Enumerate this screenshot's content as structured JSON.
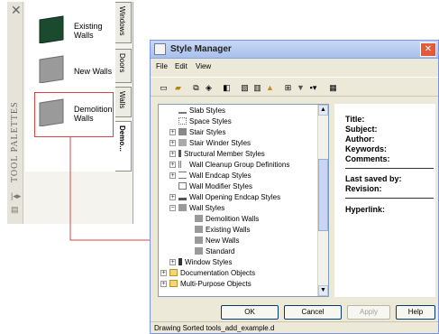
{
  "palette": {
    "title": "TOOL PALETTES",
    "tools": [
      {
        "label": "Existing Walls",
        "color": "#1b4a2e"
      },
      {
        "label": "New Walls",
        "color": "#9a9a9a"
      },
      {
        "label": "Demolition Walls",
        "color": "#9a9a9a"
      }
    ],
    "tabs": [
      "Windows",
      "Doors",
      "Walls",
      "Demo..."
    ]
  },
  "window": {
    "title": "Style Manager",
    "menus": [
      "File",
      "Edit",
      "View"
    ],
    "tree": [
      {
        "label": "Slab Styles",
        "level": 2,
        "expander": ""
      },
      {
        "label": "Space Styles",
        "level": 2,
        "expander": ""
      },
      {
        "label": "Stair Styles",
        "level": 2,
        "expander": "+"
      },
      {
        "label": "Stair Winder Styles",
        "level": 2,
        "expander": "+"
      },
      {
        "label": "Structural Member Styles",
        "level": 2,
        "expander": "+"
      },
      {
        "label": "Wall Cleanup Group Definitions",
        "level": 2,
        "expander": "+"
      },
      {
        "label": "Wall Endcap Styles",
        "level": 2,
        "expander": "+"
      },
      {
        "label": "Wall Modifier Styles",
        "level": 2,
        "expander": ""
      },
      {
        "label": "Wall Opening Endcap Styles",
        "level": 2,
        "expander": "+"
      },
      {
        "label": "Wall Styles",
        "level": 2,
        "expander": "-"
      },
      {
        "label": "Demolition Walls",
        "level": 3,
        "expander": ""
      },
      {
        "label": "Existing Walls",
        "level": 3,
        "expander": ""
      },
      {
        "label": "New Walls",
        "level": 3,
        "expander": ""
      },
      {
        "label": "Standard",
        "level": 3,
        "expander": ""
      },
      {
        "label": "Window Styles",
        "level": 2,
        "expander": "+"
      },
      {
        "label": "Documentation Objects",
        "level": 1,
        "expander": "+"
      },
      {
        "label": "Multi-Purpose Objects",
        "level": 1,
        "expander": "+"
      }
    ],
    "properties": {
      "title": "Title:",
      "subject": "Subject:",
      "author": "Author:",
      "keywords": "Keywords:",
      "comments": "Comments:",
      "last_saved_by": "Last saved by:",
      "revision": "Revision:",
      "hyperlink": "Hyperlink:"
    },
    "buttons": {
      "ok": "OK",
      "cancel": "Cancel",
      "apply": "Apply",
      "help": "Help"
    },
    "status": "Drawing Sorted  tools_add_example.d",
    "colors": {
      "highlight": "#d84444",
      "title_bar": "#a8c0ec"
    }
  }
}
